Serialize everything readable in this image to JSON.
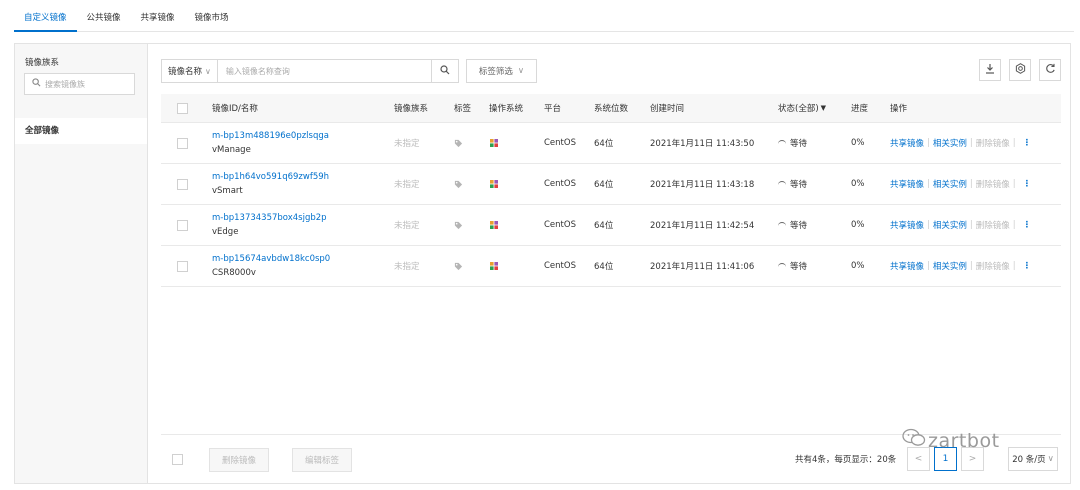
{
  "tabs": [
    {
      "label": "自定义镜像",
      "active": true
    },
    {
      "label": "公共镜像",
      "active": false
    },
    {
      "label": "共享镜像",
      "active": false
    },
    {
      "label": "镜像市场",
      "active": false
    }
  ],
  "sidebar": {
    "title": "镜像族系",
    "search_placeholder": "搜索镜像族",
    "items": [
      {
        "label": "全部镜像",
        "selected": true
      }
    ]
  },
  "toolbar": {
    "filter_key": "镜像名称",
    "filter_placeholder": "输入镜像名称查询",
    "tag_filter_label": "标签筛选"
  },
  "table": {
    "headers": {
      "id_name": "镜像ID/名称",
      "family": "镜像族系",
      "tag": "标签",
      "os": "操作系统",
      "platform": "平台",
      "bits": "系统位数",
      "created": "创建时间",
      "status": "状态(全部)",
      "progress": "进度",
      "ops": "操作"
    },
    "rows": [
      {
        "id": "m-bp13m488196e0pzlsqga",
        "name": "vManage",
        "family": "未指定",
        "platform": "CentOS",
        "bits": "64位",
        "created": "2021年1月11日 11:43:50",
        "status": "等待",
        "progress": "0%"
      },
      {
        "id": "m-bp1h64vo591q69zwf59h",
        "name": "vSmart",
        "family": "未指定",
        "platform": "CentOS",
        "bits": "64位",
        "created": "2021年1月11日 11:43:18",
        "status": "等待",
        "progress": "0%"
      },
      {
        "id": "m-bp13734357box4sjgb2p",
        "name": "vEdge",
        "family": "未指定",
        "platform": "CentOS",
        "bits": "64位",
        "created": "2021年1月11日 11:42:54",
        "status": "等待",
        "progress": "0%"
      },
      {
        "id": "m-bp15674avbdw18kc0sp0",
        "name": "CSR8000v",
        "family": "未指定",
        "platform": "CentOS",
        "bits": "64位",
        "created": "2021年1月11日 11:41:06",
        "status": "等待",
        "progress": "0%"
      }
    ],
    "ops": {
      "share": "共享镜像",
      "related": "相关实例",
      "delete": "删除镜像",
      "more": "⋮"
    }
  },
  "footer": {
    "delete_label": "删除镜像",
    "edit_tags_label": "编辑标签",
    "page_info": "共有4条，每页显示：20条",
    "current_page": "1",
    "prev": "<",
    "next": ">",
    "page_size": "20 条/页"
  },
  "watermark": "zartbot",
  "colors": {
    "accent": "#0070cc",
    "border": "#d9d9d9",
    "sidebar_bg": "#f7f7f7"
  }
}
